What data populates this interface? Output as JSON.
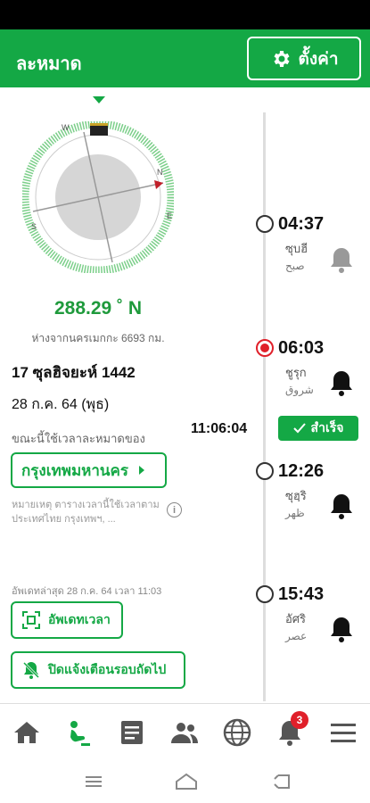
{
  "header": {
    "title": "ละหมาด",
    "settings_label": "ตั้งค่า"
  },
  "qibla": {
    "direction": "288.29 ˚ N",
    "distance": "ห่างจากนครเมกกะ 6693 กม.",
    "compass_letters": [
      "N",
      "E",
      "S",
      "W"
    ]
  },
  "dates": {
    "hijri": "17 ซุลฮิจยะห์ 1442",
    "gregorian": "28 ก.ค. 64 (พุธ)"
  },
  "location": {
    "using_label": "ขณะนี้ใช้เวลาละหมาดของ",
    "city": "กรุงเทพมหานคร",
    "note": "หมายเหตุ ตารางเวลานี้ใช้เวลาตามประเทศไทย กรุงเทพฯ, ..."
  },
  "updated_text": "อัพเดทล่าสุด 28 ก.ค. 64 เวลา 11:03",
  "buttons": {
    "update_time": "อัพเดทเวลา",
    "mute_next": "ปิดแจ้งเตือนรอบถัดไป"
  },
  "current_time": "11:06:04",
  "status": {
    "success_label": "สำเร็จ"
  },
  "prayers": [
    {
      "time": "04:37",
      "name": "ซุบฮี",
      "arabic": "صبح",
      "active": false
    },
    {
      "time": "06:03",
      "name": "ชูรุก",
      "arabic": "شروق",
      "active": true
    },
    {
      "time": "12:26",
      "name": "ซุฮฺริ",
      "arabic": "ظهر",
      "active": false
    },
    {
      "time": "15:43",
      "name": "อัศริ",
      "arabic": "عصر",
      "active": false
    }
  ],
  "nav": {
    "items": [
      "home-icon",
      "prayer-icon",
      "document-icon",
      "people-icon",
      "globe-icon",
      "bell-icon",
      "menu-icon"
    ],
    "notification_count": "3"
  },
  "colors": {
    "brand": "#14a845",
    "active": "#e0202a"
  }
}
